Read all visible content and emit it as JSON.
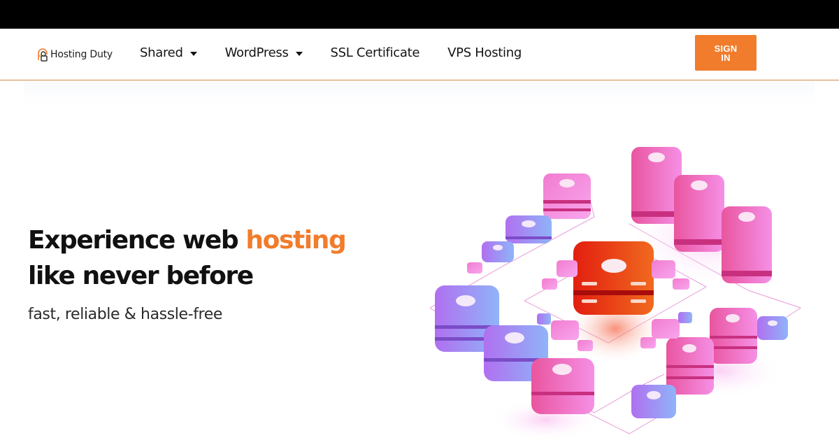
{
  "topbar": {
    "announcement": "· · · · · · · · · · · · · · · · · · · · · ·",
    "right_text_line1": "· · · ·",
    "right_text_line2": "· ·"
  },
  "header": {
    "logo_text": "Hosting Duty",
    "logo_icon": "hd-monogram-icon",
    "nav": [
      {
        "label": "Shared",
        "has_dropdown": true
      },
      {
        "label": "WordPress",
        "has_dropdown": true
      },
      {
        "label": "SSL Certificate",
        "has_dropdown": false
      },
      {
        "label": "VPS Hosting",
        "has_dropdown": false
      }
    ],
    "signin_label": "SIGN IN"
  },
  "hero": {
    "title_part1": "Experience web ",
    "title_accent": "hosting",
    "title_line2": "like never before",
    "subtitle": "fast, reliable & hassle-free",
    "illustration": "isometric-server-network-illustration"
  },
  "colors": {
    "accent": "#f07c2c",
    "topbar_bg": "#000000",
    "text": "#111111",
    "server_pink": "#f06cc0",
    "server_purple": "#a77cf0",
    "server_core": "#e8361c"
  }
}
